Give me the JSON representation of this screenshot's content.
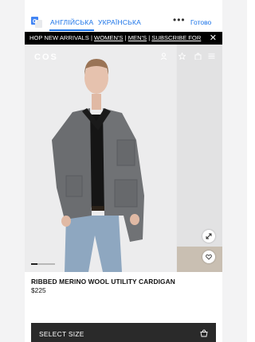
{
  "translate_bar": {
    "tab_english": "АНГЛІЙСЬКА",
    "tab_ukrainian": "УКРАЇНСЬКА",
    "more": "•••",
    "done": "Готово"
  },
  "banner": {
    "prefix": "HOP NEW ARRIVALS | ",
    "womens": "WOMEN'S",
    "sep1": " | ",
    "mens": "MEN'S",
    "sep2": " | ",
    "subscribe": "SUBSCRIBE FOR",
    "close": "✕"
  },
  "header": {
    "logo": "COS"
  },
  "carousel": {
    "slide_count": 3,
    "active_slide": 1
  },
  "product": {
    "name": "RIBBED MERINO WOOL UTILITY CARDIGAN",
    "price": "$225"
  },
  "actions": {
    "select_size": "SELECT SIZE"
  },
  "colors": {
    "accent": "#1a73e8",
    "banner_bg": "#000000",
    "cta_bg": "#2a2a2a"
  }
}
